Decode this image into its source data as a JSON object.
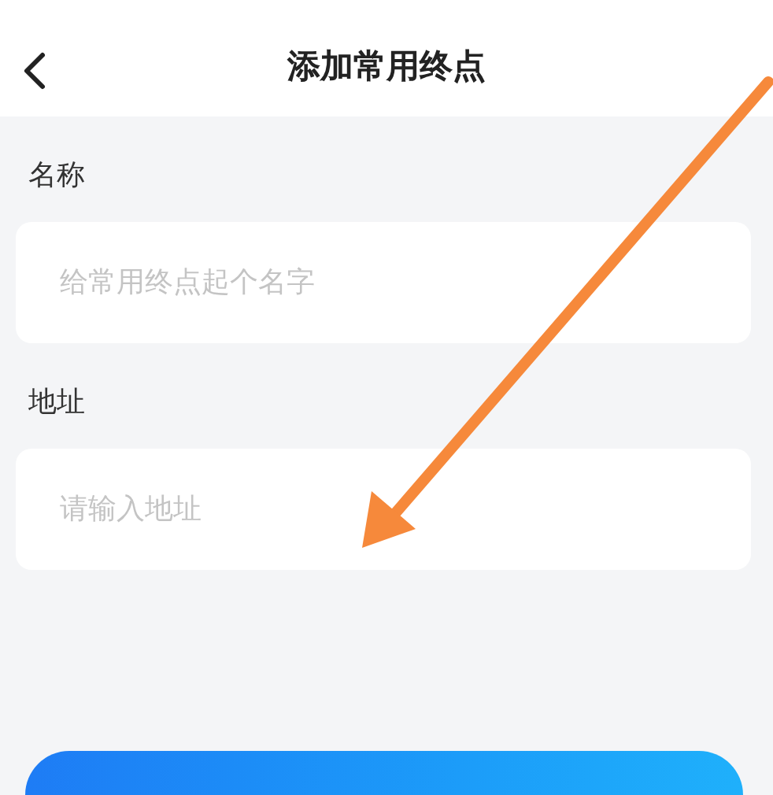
{
  "header": {
    "title": "添加常用终点"
  },
  "fields": [
    {
      "label": "名称",
      "placeholder": "给常用终点起个名字"
    },
    {
      "label": "地址",
      "placeholder": "请输入地址"
    }
  ]
}
